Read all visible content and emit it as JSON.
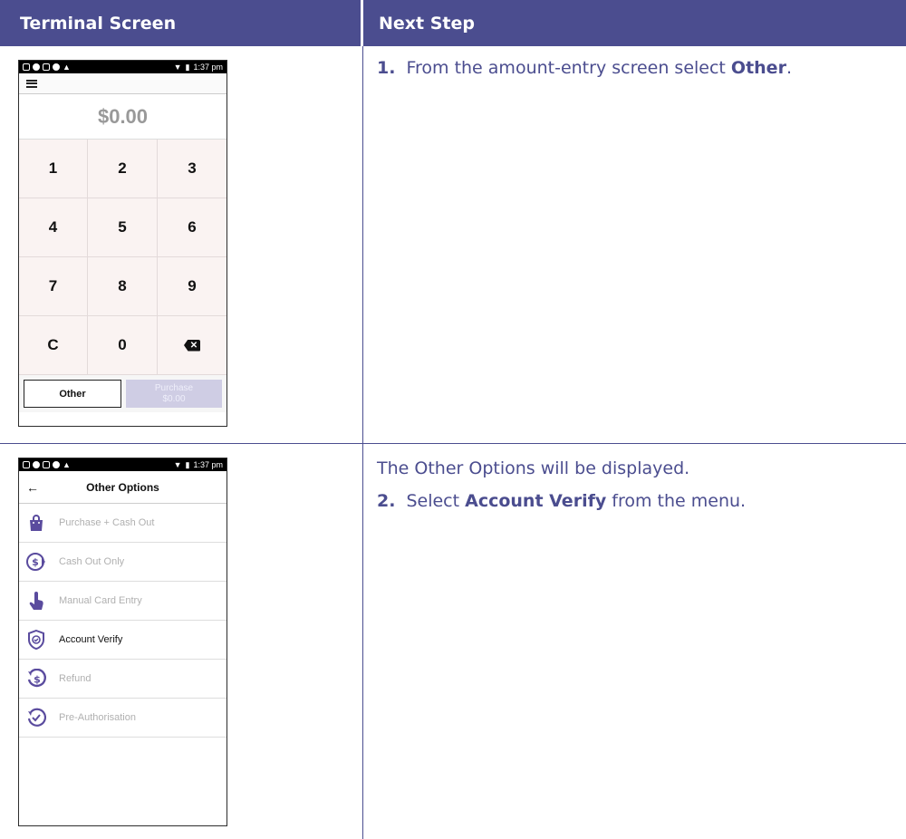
{
  "header": {
    "left": "Terminal Screen",
    "right": "Next Step"
  },
  "steps": {
    "s1_num": "1.",
    "s1_pre": "From the amount-entry screen select ",
    "s1_bold": "Other",
    "s1_post": ".",
    "intro2": "The Other Options will be displayed.",
    "s2_num": "2.",
    "s2_pre": "Select ",
    "s2_bold": "Account Verify",
    "s2_post": " from the menu."
  },
  "phone1": {
    "time": "1:37 pm",
    "amount": "$0.00",
    "keys": [
      "1",
      "2",
      "3",
      "4",
      "5",
      "6",
      "7",
      "8",
      "9",
      "C",
      "0"
    ],
    "other_label": "Other",
    "purchase_label": "Purchase",
    "purchase_amount": "$0.00"
  },
  "phone2": {
    "time": "1:37 pm",
    "title": "Other Options",
    "options": [
      {
        "label": "Purchase + Cash Out",
        "icon": "shopping-bag-icon"
      },
      {
        "label": "Cash Out Only",
        "icon": "cash-out-icon"
      },
      {
        "label": "Manual Card Entry",
        "icon": "touch-hand-icon"
      },
      {
        "label": "Account Verify",
        "icon": "shield-check-icon"
      },
      {
        "label": "Refund",
        "icon": "refund-icon"
      },
      {
        "label": "Pre-Authorisation",
        "icon": "clock-check-icon"
      }
    ]
  },
  "colors": {
    "brand": "#4b4d8f",
    "icon_purple": "#5a4b9e"
  }
}
